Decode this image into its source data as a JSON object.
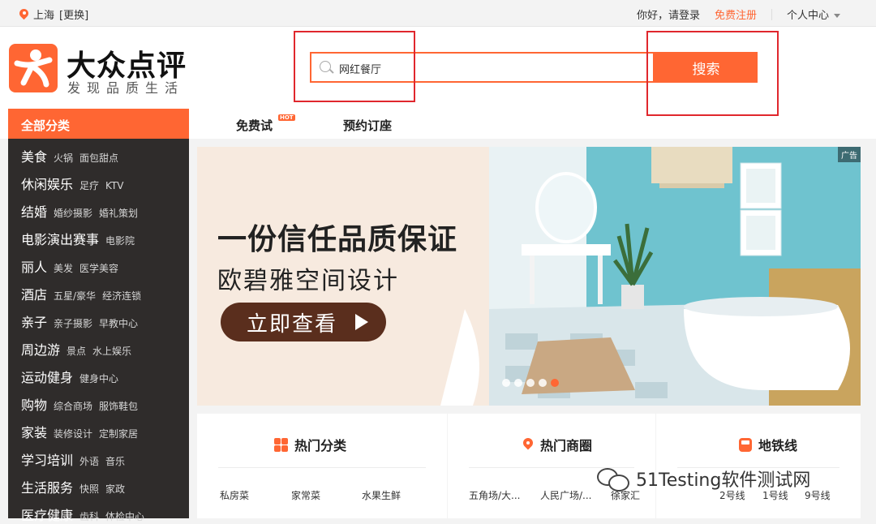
{
  "topbar": {
    "city": "上海",
    "change": "[更换]",
    "greeting": "你好，请登录",
    "register": "免费注册",
    "personal": "个人中心"
  },
  "header": {
    "brand": "大众点评",
    "slogan": "发现品质生活"
  },
  "search": {
    "value": "网红餐厅",
    "button": "搜索"
  },
  "nav": {
    "all_categories": "全部分类",
    "free_trial": "免费试",
    "free_trial_badge": "HOT",
    "reserve": "预约订座"
  },
  "sidebar": {
    "items": [
      {
        "main": "美食",
        "subs": [
          "火锅",
          "面包甜点"
        ]
      },
      {
        "main": "休闲娱乐",
        "subs": [
          "足疗",
          "KTV"
        ]
      },
      {
        "main": "结婚",
        "subs": [
          "婚纱摄影",
          "婚礼策划"
        ]
      },
      {
        "main": "电影演出赛事",
        "subs": [
          "电影院"
        ]
      },
      {
        "main": "丽人",
        "subs": [
          "美发",
          "医学美容"
        ]
      },
      {
        "main": "酒店",
        "subs": [
          "五星/豪华",
          "经济连锁"
        ]
      },
      {
        "main": "亲子",
        "subs": [
          "亲子摄影",
          "早教中心"
        ]
      },
      {
        "main": "周边游",
        "subs": [
          "景点",
          "水上娱乐"
        ]
      },
      {
        "main": "运动健身",
        "subs": [
          "健身中心"
        ]
      },
      {
        "main": "购物",
        "subs": [
          "综合商场",
          "服饰鞋包"
        ]
      },
      {
        "main": "家装",
        "subs": [
          "装修设计",
          "定制家居"
        ]
      },
      {
        "main": "学习培训",
        "subs": [
          "外语",
          "音乐"
        ]
      },
      {
        "main": "生活服务",
        "subs": [
          "快照",
          "家政"
        ]
      },
      {
        "main": "医疗健康",
        "subs": [
          "齿科",
          "体检中心"
        ]
      }
    ]
  },
  "banner": {
    "ad_label": "广告",
    "title": "一份信任品质保证",
    "subtitle": "欧碧雅空间设计",
    "cta": "立即查看",
    "slide_count": 5,
    "active_slide": 5
  },
  "panels": {
    "hot_categories": {
      "title": "热门分类",
      "links": [
        "私房菜",
        "家常菜",
        "水果生鲜"
      ]
    },
    "hot_areas": {
      "title": "热门商圈",
      "links": [
        "五角场/大...",
        "人民广场/...",
        "徐家汇"
      ]
    },
    "metro": {
      "title": "地铁线",
      "links": [
        "2号线",
        "1号线",
        "9号线"
      ]
    }
  },
  "watermark": "51Testing软件测试网",
  "colors": {
    "accent": "#ff6633",
    "sidebar": "#2f2c2b",
    "highlight_box": "#e0272d"
  }
}
